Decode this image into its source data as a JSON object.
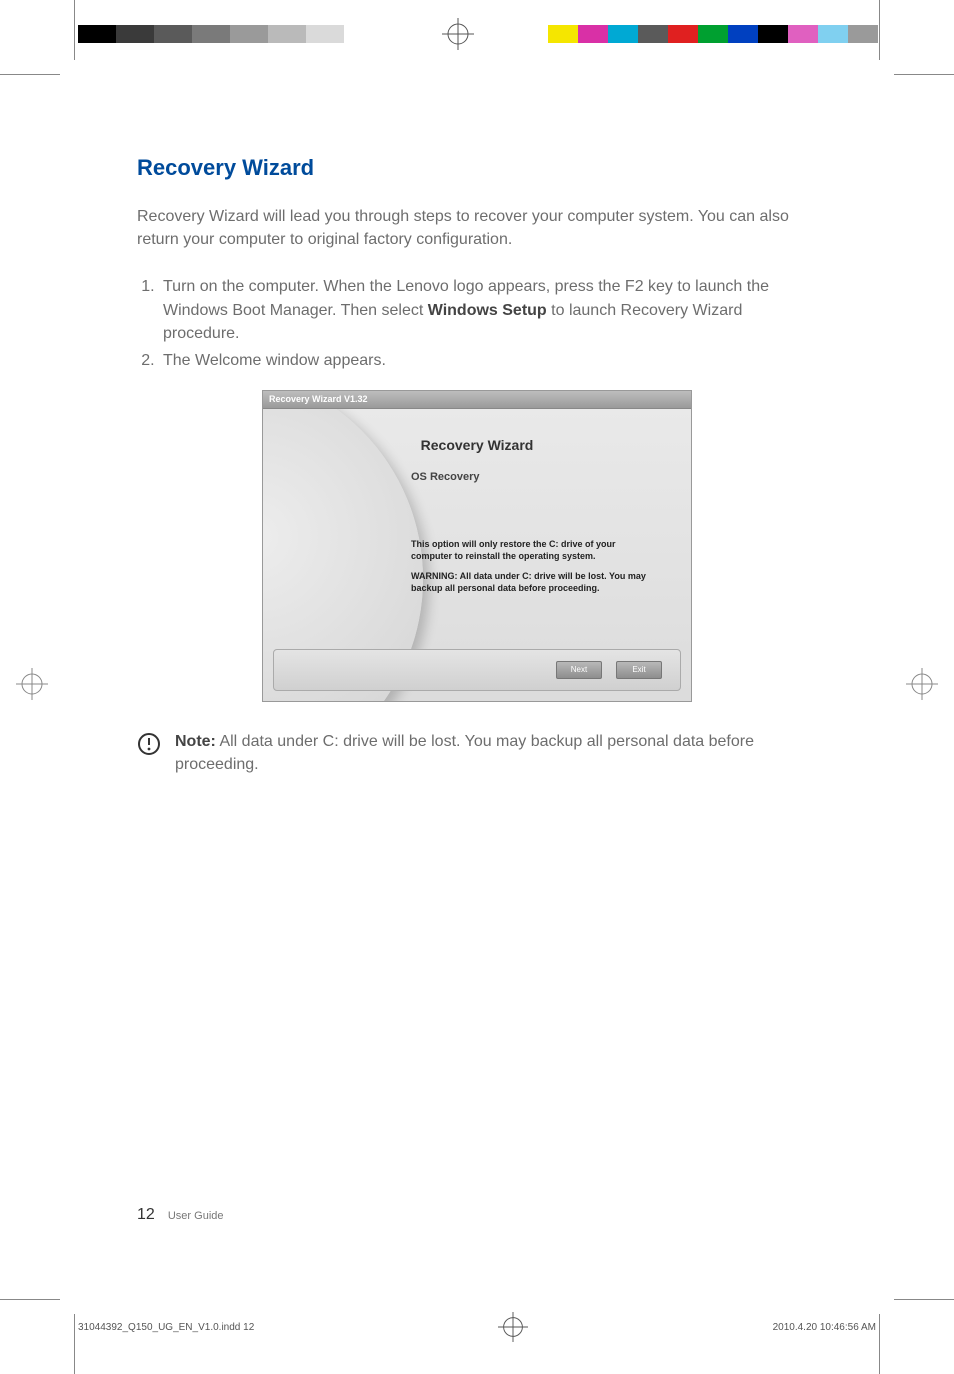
{
  "section": {
    "title": "Recovery Wizard",
    "intro": "Recovery Wizard will lead you through steps to recover your computer system. You can also return your computer to original factory configuration."
  },
  "steps": {
    "item1_pre": "Turn on the computer. When the Lenovo logo appears, press the F2 key to launch the Windows Boot Manager. Then select ",
    "item1_bold": "Windows Setup",
    "item1_post": " to launch Recovery Wizard procedure.",
    "item2": "The Welcome window appears."
  },
  "dialog": {
    "titlebar": "Recovery Wizard V1.32",
    "heading": "Recovery Wizard",
    "subheading": "OS Recovery",
    "msg1": "This option will only restore the C: drive of your computer to reinstall the operating system.",
    "msg2": "WARNING: All data under C: drive will be lost. You may backup all personal data before proceeding.",
    "button_next": "Next",
    "button_exit": "Exit"
  },
  "note": {
    "label": "Note:",
    "text": " All data under C: drive will be lost. You may backup all personal data before proceeding."
  },
  "footer": {
    "page_number": "12",
    "doc_label": "User Guide"
  },
  "print": {
    "file": "31044392_Q150_UG_EN_V1.0.indd   12",
    "date": "2010.4.20   10:46:56 AM"
  },
  "swatches_left": [
    "#000000",
    "#3a3a3a",
    "#5a5a5a",
    "#7a7a7a",
    "#9a9a9a",
    "#bababa",
    "#dadada",
    "#ffffff"
  ],
  "swatches_right": [
    "#f5e600",
    "#d930a6",
    "#00a9d4",
    "#5a5a5a",
    "#e02020",
    "#00a030",
    "#0040c0",
    "#000000",
    "#e060c0",
    "#80d0f0",
    "#9a9a9a"
  ]
}
